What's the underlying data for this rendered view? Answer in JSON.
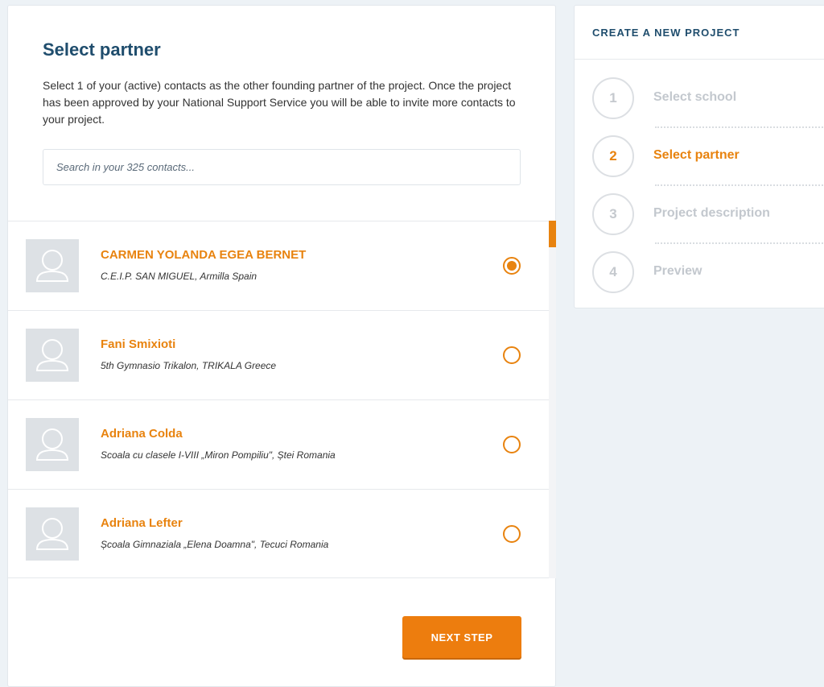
{
  "main": {
    "title": "Select partner",
    "intro": "Select 1 of your (active) contacts as the other founding partner of the project. Once the project has been approved by your National Support Service you will be able to invite more contacts to your project.",
    "search_placeholder": "Search in your 325 contacts...",
    "contacts": [
      {
        "name": "CARMEN YOLANDA EGEA BERNET",
        "school": "C.E.I.P. SAN MIGUEL, Armilla Spain",
        "selected": true
      },
      {
        "name": "Fani Smixioti",
        "school": "5th Gymnasio Trikalon, TRIKALA Greece",
        "selected": false
      },
      {
        "name": "Adriana Colda",
        "school": "Scoala cu clasele I-VIII „Miron Pompiliu\", Ștei Romania",
        "selected": false
      },
      {
        "name": "Adriana Lefter",
        "school": "Școala Gimnaziala „Elena Doamna\", Tecuci Romania",
        "selected": false
      }
    ],
    "next_label": "NEXT STEP"
  },
  "sidebar": {
    "title": "CREATE A NEW PROJECT",
    "steps": [
      {
        "num": "1",
        "label": "Select school",
        "active": false
      },
      {
        "num": "2",
        "label": "Select partner",
        "active": true
      },
      {
        "num": "3",
        "label": "Project description",
        "active": false
      },
      {
        "num": "4",
        "label": "Preview",
        "active": false
      }
    ]
  },
  "colors": {
    "accent": "#e8830f",
    "title": "#1f4d6d",
    "background": "#edf2f6"
  },
  "icons": {
    "avatar": "user-placeholder-icon"
  }
}
